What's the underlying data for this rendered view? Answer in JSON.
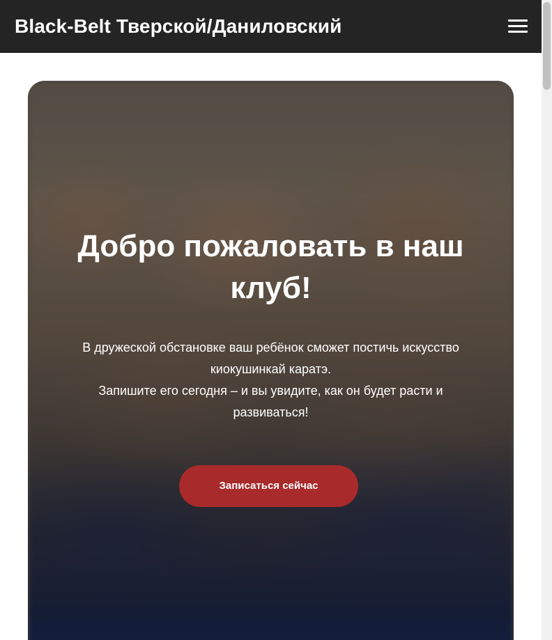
{
  "header": {
    "site_title": "Black-Belt Тверской/Даниловский",
    "menu_icon": "hamburger-menu-icon",
    "background_color": "#242424"
  },
  "hero": {
    "heading": "Добро пожаловать в наш клуб!",
    "description_line1": "В дружеской обстановке ваш ребёнок сможет постичь искусство киокушинкай каратэ.",
    "description_line2": "Запишите его сегодня – и вы увидите, как он будет расти и развиваться!",
    "cta_label": "Записаться сейчас",
    "cta_color": "#a82a2a"
  },
  "scrollbar": {
    "position_fraction": 0.0
  }
}
